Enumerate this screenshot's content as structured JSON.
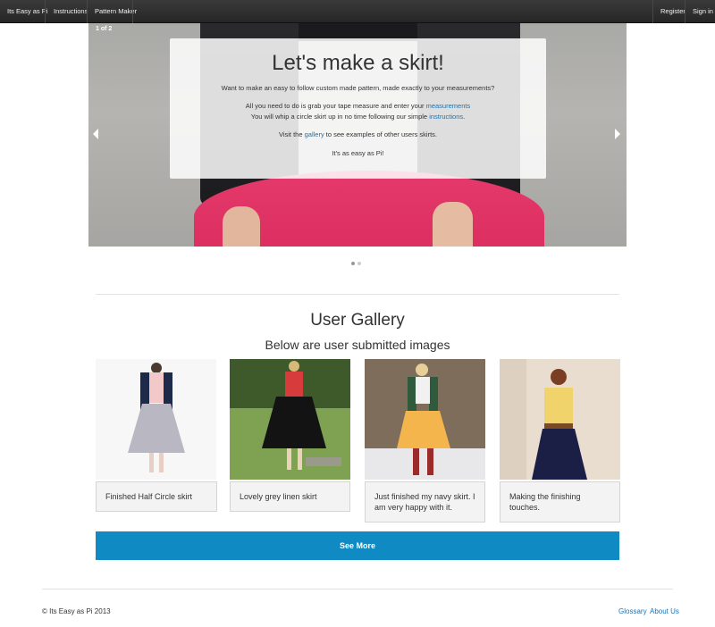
{
  "navbar": {
    "brand": "Its Easy as Pi",
    "links": [
      "Instructions",
      "Pattern Maker"
    ],
    "right_links": [
      "Register",
      "Sign in"
    ]
  },
  "hero": {
    "counter": "1 of 2",
    "title": "Let's make a skirt!",
    "line1": "Want to make an easy to follow custom made pattern, made exactly to your measurements?",
    "line2_prefix": "All you need to do is grab your tape measure and enter your ",
    "line2_link": "measurements",
    "line3_prefix": "You will whip a circle skirt up in no time following our simple ",
    "line3_link": "instructions",
    "line3_suffix": ".",
    "line4_prefix": "Visit the ",
    "line4_link": "gallery",
    "line4_suffix": " to see examples of other users skirts.",
    "line5": "It's as easy as Pi!",
    "slide_count": 2,
    "active_slide": 1
  },
  "gallery": {
    "title": "User Gallery",
    "subtitle": "Below are user submitted images",
    "items": [
      {
        "caption": "Finished Half Circle skirt"
      },
      {
        "caption": "Lovely grey linen skirt"
      },
      {
        "caption": "Just finished my navy skirt. I am very happy with it."
      },
      {
        "caption": "Making the finishing touches."
      }
    ],
    "see_more": "See More"
  },
  "footer": {
    "copyright": "© Its Easy as Pi 2013",
    "links": [
      "Glossary",
      "About Us"
    ]
  },
  "colors": {
    "navbar": "#2f2f2f",
    "link": "#1a73b5",
    "see_more": "#0f8ac2",
    "skirt_pink": "#e0356a"
  }
}
